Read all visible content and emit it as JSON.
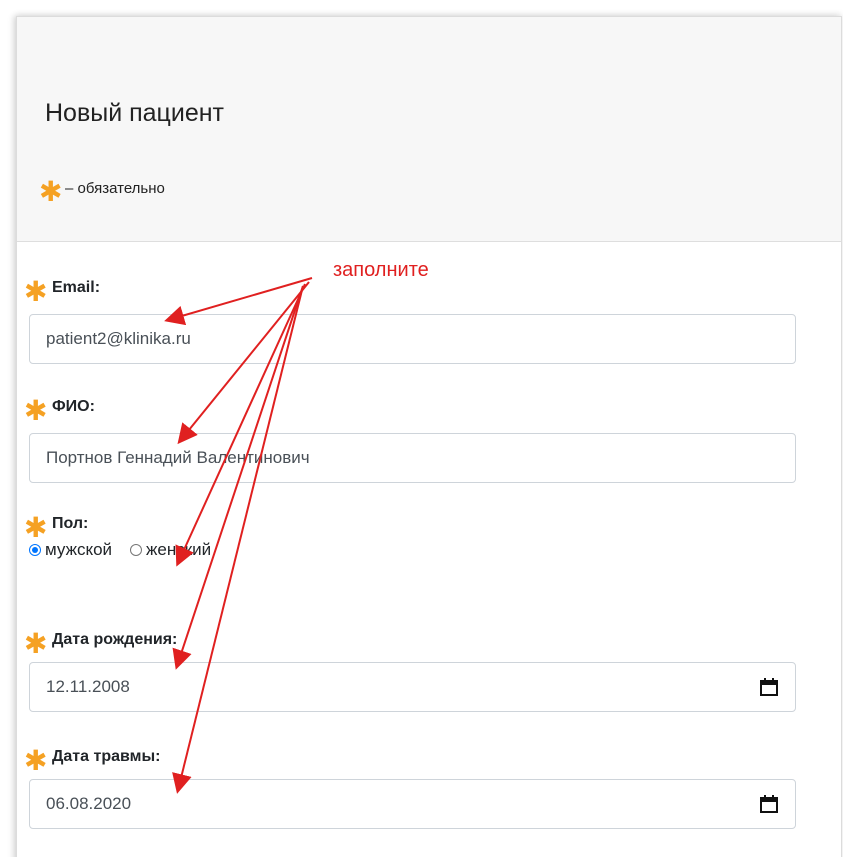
{
  "form": {
    "title": "Новый пациент",
    "required_note": "– обязательно",
    "required_symbol": "✱"
  },
  "fields": {
    "email": {
      "label": "Email:",
      "value": "patient2@klinika.ru"
    },
    "fio": {
      "label": "ФИО:",
      "value": "Портнов Геннадий Валентинович"
    },
    "gender": {
      "label": "Пол:",
      "options": [
        "мужской",
        "женский"
      ],
      "selected": "мужской"
    },
    "birth_date": {
      "label": "Дата рождения:",
      "value": "12.11.2008",
      "icon": "calendar-icon"
    },
    "injury_date": {
      "label": "Дата травмы:",
      "value": "06.08.2020",
      "icon": "calendar-icon"
    }
  },
  "annotation": {
    "text": "заполните",
    "color": "#e02020"
  },
  "colors": {
    "asterisk": "#f5a123",
    "radio_checked": "#0075ff"
  }
}
